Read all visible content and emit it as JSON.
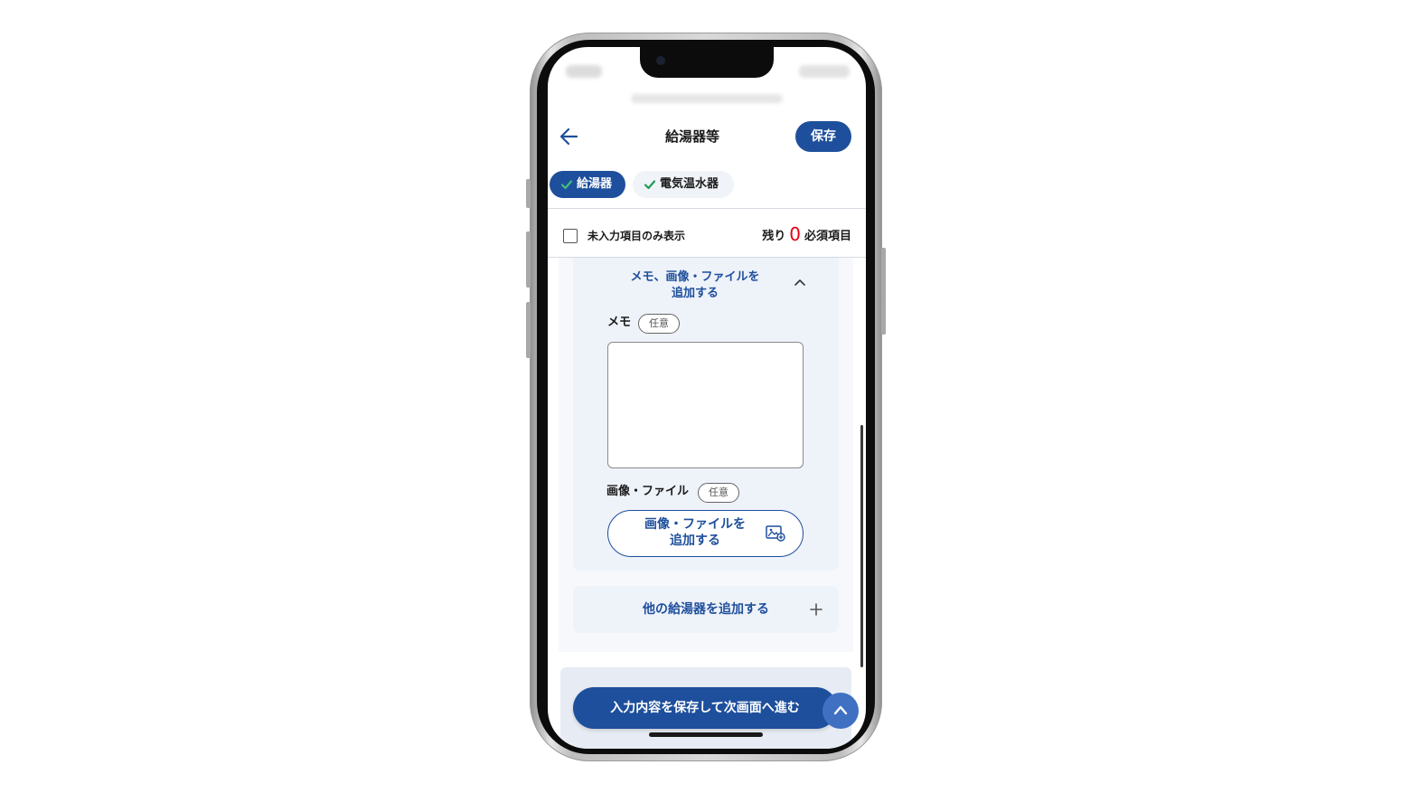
{
  "header": {
    "title": "給湯器等",
    "save_label": "保存",
    "back_icon": "arrow-left-icon"
  },
  "tabs": [
    {
      "label": "給湯器",
      "active": true,
      "completed": true
    },
    {
      "label": "電気温水器",
      "active": false,
      "completed": true
    }
  ],
  "filter": {
    "checkbox_label": "未入力項目のみ表示",
    "checked": false,
    "remaining_prefix": "残り",
    "remaining_count": "0",
    "remaining_suffix": "必須項目"
  },
  "attachments": {
    "accordion_title_line1": "メモ、画像・ファイルを",
    "accordion_title_line2": "追加する",
    "memo_label": "メモ",
    "memo_badge": "任意",
    "memo_value": "",
    "file_label": "画像・ファイル",
    "file_badge": "任意",
    "file_button_line1": "画像・ファイルを",
    "file_button_line2": "追加する"
  },
  "add_other_label": "他の給湯器を追加する",
  "footer": {
    "next_button_label": "入力内容を保存して次画面へ進む"
  },
  "colors": {
    "primary": "#1e4f9c",
    "accent_check": "#1f9d55",
    "alert_red": "#e60012",
    "panel_bg": "#eef2f9"
  }
}
